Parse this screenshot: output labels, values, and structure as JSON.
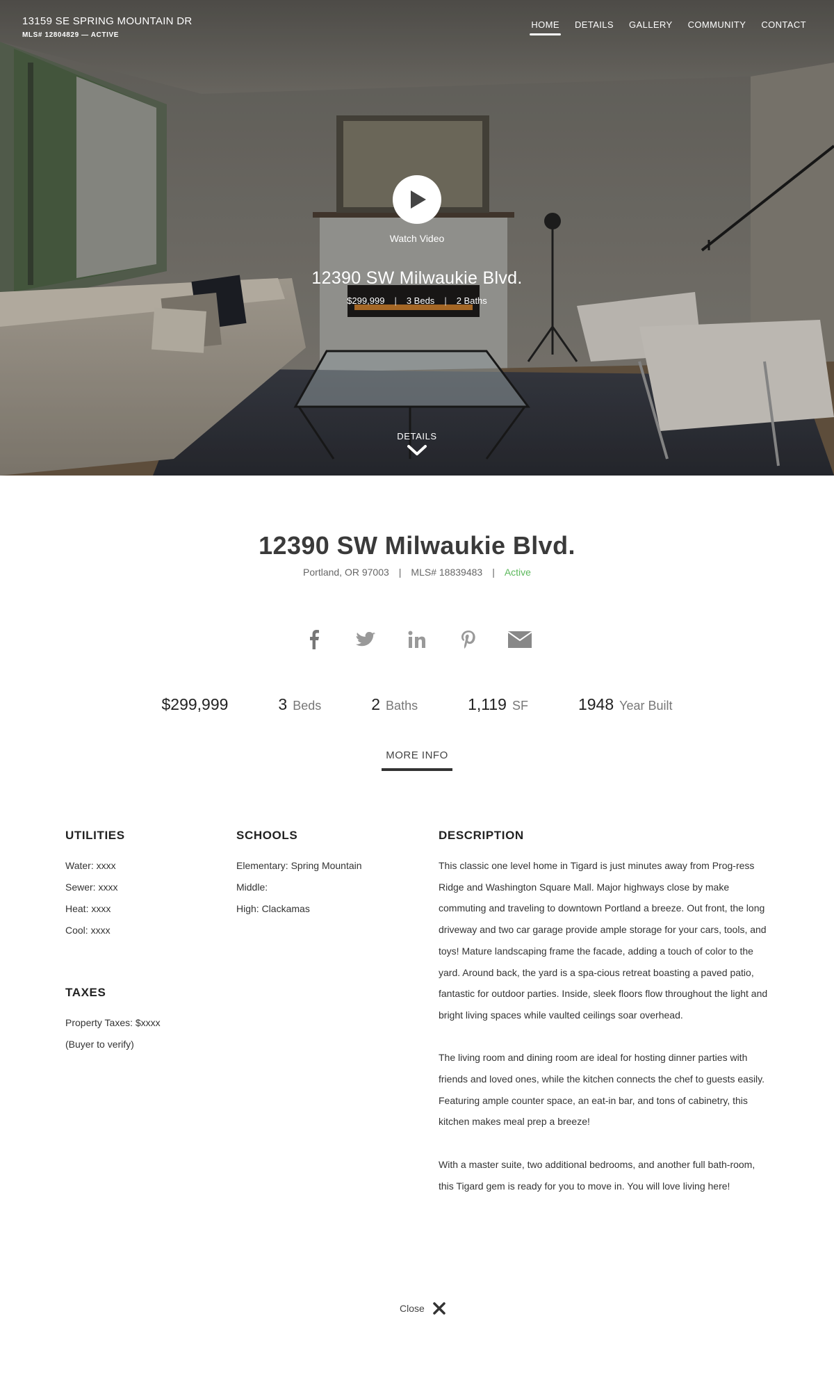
{
  "brand": {
    "address": "13159 SE SPRING MOUNTAIN DR",
    "mls_line": "MLS# 12804829  —  ACTIVE"
  },
  "nav": {
    "items": [
      "HOME",
      "DETAILS",
      "GALLERY",
      "COMMUNITY",
      "CONTACT"
    ],
    "active": "HOME"
  },
  "hero": {
    "watch_label": "Watch Video",
    "title": "12390 SW Milwaukie Blvd.",
    "price": "$299,999",
    "beds": "3 Beds",
    "baths": "2 Baths",
    "separator": "|",
    "details_label": "DETAILS"
  },
  "listing": {
    "title": "12390 SW Milwaukie Blvd.",
    "location": "Portland, OR 97003",
    "mls": "MLS# 18839483",
    "status": "Active",
    "separator": "|"
  },
  "share_icons": [
    "facebook-icon",
    "twitter-icon",
    "linkedin-icon",
    "pinterest-icon",
    "email-icon"
  ],
  "stats": {
    "price": "$299,999",
    "beds_num": "3",
    "beds_unit": "Beds",
    "baths_num": "2",
    "baths_unit": "Baths",
    "sf_num": "1,119",
    "sf_unit": "SF",
    "year_num": "1948",
    "year_unit": "Year Built"
  },
  "more_info_label": "MORE INFO",
  "utilities": {
    "heading": "UTILITIES",
    "items": [
      "Water: xxxx",
      "Sewer: xxxx",
      "Heat: xxxx",
      "Cool: xxxx"
    ]
  },
  "schools": {
    "heading": "SCHOOLS",
    "items": [
      "Elementary: Spring Mountain",
      "Middle:",
      "High: Clackamas"
    ]
  },
  "taxes": {
    "heading": "TAXES",
    "items": [
      "Property Taxes: $xxxx",
      "(Buyer to verify)"
    ]
  },
  "description": {
    "heading": "DESCRIPTION",
    "paragraphs": [
      "This classic one level home in Tigard is just minutes away from Prog-ress Ridge and Washington Square Mall. Major highways close by make commuting and traveling to downtown Portland a breeze. Out front, the long driveway and two car garage provide ample storage for your cars, tools, and toys! Mature landscaping frame the facade, adding a touch of color to the yard. Around back, the yard is a spa-cious retreat boasting a paved patio, fantastic for outdoor parties. Inside, sleek floors flow throughout the light and bright living spaces while vaulted ceilings soar overhead.",
      "The living room and dining room are ideal for hosting dinner parties with friends and loved ones, while the kitchen connects the chef to guests easily. Featuring ample counter space, an eat-in bar, and tons of cabinetry, this kitchen makes meal prep a breeze!",
      "With a master suite, two additional bedrooms, and another full bath-room, this Tigard gem is ready for you to move in. You will love living here!"
    ]
  },
  "close_label": "Close",
  "colors": {
    "status_active": "#5cb85c",
    "text_dark": "#333333",
    "icon_gray": "#8a8a8a"
  }
}
